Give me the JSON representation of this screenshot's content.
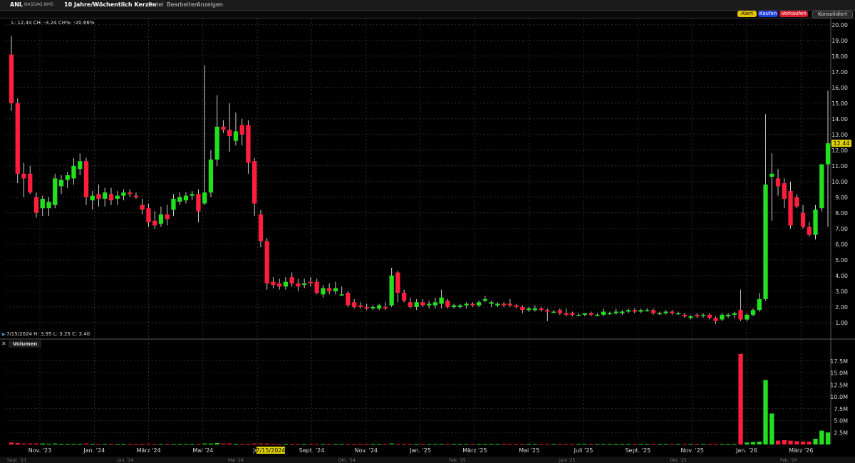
{
  "toolbar": {
    "symbol": "ANL",
    "exchange": "NASDAQ.NMS",
    "period_label": "10 Jahre/Wöchentlich Kerzen",
    "menu": [
      "Datei",
      "Bearbeiten",
      "Anzeigen"
    ],
    "buttons": {
      "alert": "Alert",
      "buy": "Kaufen",
      "sell": "Verkaufen",
      "consolidated": "Konsolidiert"
    }
  },
  "legend_text": "L: 12.44 CH: -3.24 CH%: -20.66%",
  "hover_text": "7/15/2024  H: 3.95  L: 3.25  C: 3.40",
  "volume_label": "Volumen",
  "last_price_label": "12.44",
  "crosshair_date_label": "7/15/2024",
  "colors": {
    "up": "#22e01e",
    "down": "#ff1e3c",
    "grid": "#4a4a4a",
    "last_price_tag": "#e3d400"
  },
  "chart_data": {
    "type": "candlestick",
    "price_axis": {
      "ticks": [
        "1.00",
        "2.00",
        "3.00",
        "4.00",
        "5.00",
        "6.00",
        "7.00",
        "8.00",
        "9.00",
        "10.00",
        "11.00",
        "12.00",
        "13.00",
        "14.00",
        "15.00",
        "16.00",
        "17.00",
        "18.00",
        "19.00",
        "20.00"
      ],
      "range": [
        0.45,
        20.4
      ]
    },
    "volume_axis": {
      "ticks": [
        "2.5M",
        "5.0M",
        "7.5M",
        "10.0M",
        "12.5M",
        "15.0M",
        "17.5M"
      ],
      "range": [
        0,
        20
      ]
    },
    "x_labels": [
      "Nov. '23",
      "Jan. '24",
      "März '24",
      "Mai '24",
      "Juli",
      "Sept. '24",
      "Nov. '24",
      "Jan. '25",
      "März '25",
      "Mai '25",
      "Juli '25",
      "Sept. '25",
      "Nov. '25",
      "Jan. '26",
      "März '26"
    ],
    "secondary_x_labels": [
      "Sept. '23",
      "Jan. '24",
      "Mai '24",
      "Okt. '24",
      "Feb. '25",
      "Juni '25",
      "Okt. '25",
      "Feb. '26"
    ],
    "candles": [
      [
        18.1,
        19.3,
        14.5,
        15.0,
        0.4
      ],
      [
        15.0,
        15.3,
        9.9,
        10.5,
        0.3
      ],
      [
        10.5,
        11.2,
        9.0,
        10.2,
        0.2
      ],
      [
        10.5,
        11.0,
        9.2,
        9.3,
        0.2
      ],
      [
        9.0,
        9.3,
        7.7,
        8.0,
        0.2
      ],
      [
        8.3,
        9.1,
        7.8,
        8.9,
        0.2
      ],
      [
        8.3,
        9.0,
        7.8,
        8.7,
        0.1
      ],
      [
        8.5,
        10.5,
        8.3,
        10.2,
        0.2
      ],
      [
        9.7,
        10.4,
        9.2,
        10.1,
        0.1
      ],
      [
        10.1,
        10.6,
        9.6,
        10.4,
        0.1
      ],
      [
        10.2,
        11.5,
        9.8,
        11.0,
        0.1
      ],
      [
        10.8,
        11.8,
        10.4,
        11.3,
        0.1
      ],
      [
        11.3,
        11.5,
        8.5,
        9.0,
        0.2
      ],
      [
        8.8,
        9.4,
        8.2,
        9.1,
        0.1
      ],
      [
        9.2,
        9.8,
        8.4,
        8.9,
        0.1
      ],
      [
        8.9,
        9.6,
        8.4,
        9.3,
        0.1
      ],
      [
        9.2,
        9.6,
        8.5,
        8.8,
        0.1
      ],
      [
        8.9,
        9.4,
        8.5,
        9.1,
        0.1
      ],
      [
        9.1,
        9.5,
        8.8,
        9.3,
        0.1
      ],
      [
        9.3,
        9.5,
        9.0,
        9.2,
        0.1
      ],
      [
        9.1,
        9.3,
        8.9,
        9.0,
        0.1
      ],
      [
        8.5,
        8.9,
        7.9,
        8.2,
        0.1
      ],
      [
        8.3,
        8.6,
        7.1,
        7.4,
        0.1
      ],
      [
        7.5,
        8.1,
        7.0,
        7.2,
        0.1
      ],
      [
        7.3,
        8.4,
        7.1,
        7.9,
        0.1
      ],
      [
        7.9,
        8.5,
        7.2,
        7.6,
        0.1
      ],
      [
        8.2,
        9.2,
        7.8,
        8.9,
        0.1
      ],
      [
        8.7,
        9.3,
        8.5,
        9.0,
        0.1
      ],
      [
        8.8,
        9.3,
        8.6,
        9.1,
        0.1
      ],
      [
        9.1,
        9.4,
        8.8,
        9.2,
        0.1
      ],
      [
        9.2,
        9.5,
        7.4,
        8.1,
        0.1
      ],
      [
        8.6,
        17.4,
        8.5,
        9.3,
        0.2
      ],
      [
        9.3,
        12.0,
        9.0,
        11.4,
        0.2
      ],
      [
        11.4,
        15.5,
        11.0,
        13.5,
        0.3
      ],
      [
        13.5,
        13.9,
        13.1,
        13.3,
        0.2
      ],
      [
        13.3,
        15.0,
        11.9,
        12.9,
        0.2
      ],
      [
        12.6,
        14.4,
        12.3,
        13.2,
        0.1
      ],
      [
        13.6,
        14.0,
        12.3,
        13.0,
        0.1
      ],
      [
        13.6,
        13.9,
        10.5,
        11.2,
        0.1
      ],
      [
        11.3,
        11.5,
        7.8,
        8.6,
        0.2
      ],
      [
        7.9,
        8.2,
        5.8,
        6.2,
        0.2
      ],
      [
        6.2,
        6.4,
        3.1,
        3.5,
        0.2
      ],
      [
        3.6,
        3.9,
        3.2,
        3.4,
        0.1
      ],
      [
        3.5,
        3.8,
        3.1,
        3.3,
        0.1
      ],
      [
        3.3,
        3.9,
        3.1,
        3.6,
        0.1
      ],
      [
        3.9,
        4.2,
        3.3,
        3.5,
        0.1
      ],
      [
        3.5,
        3.8,
        3.0,
        3.3,
        0.1
      ],
      [
        3.4,
        3.8,
        3.2,
        3.5,
        0.1
      ],
      [
        3.6,
        3.9,
        3.3,
        3.5,
        0.1
      ],
      [
        3.6,
        3.8,
        2.8,
        2.9,
        0.1
      ],
      [
        2.8,
        3.4,
        2.6,
        3.2,
        0.1
      ],
      [
        3.2,
        3.5,
        2.8,
        3.0,
        0.1
      ],
      [
        3.0,
        3.6,
        2.8,
        3.2,
        0.1
      ],
      [
        2.8,
        3.3,
        2.7,
        2.8,
        0.1
      ],
      [
        2.9,
        3.0,
        2.0,
        2.1,
        0.1
      ],
      [
        2.3,
        2.5,
        1.9,
        2.0,
        0.1
      ],
      [
        2.1,
        2.3,
        1.9,
        2.0,
        0.1
      ],
      [
        2.0,
        2.2,
        1.8,
        1.9,
        0.1
      ],
      [
        1.9,
        2.1,
        1.8,
        2.0,
        0.1
      ],
      [
        1.9,
        2.2,
        1.8,
        2.1,
        0.1
      ],
      [
        2.0,
        2.3,
        1.8,
        1.9,
        0.1
      ],
      [
        2.1,
        4.5,
        2.0,
        4.0,
        0.2
      ],
      [
        4.2,
        4.3,
        2.3,
        2.9,
        0.1
      ],
      [
        2.9,
        3.1,
        2.3,
        2.4,
        0.1
      ],
      [
        2.3,
        2.6,
        1.9,
        2.0,
        0.1
      ],
      [
        2.0,
        2.5,
        1.8,
        2.3,
        0.1
      ],
      [
        2.3,
        2.5,
        2.0,
        2.1,
        0.1
      ],
      [
        2.1,
        2.4,
        1.9,
        2.2,
        0.1
      ],
      [
        2.1,
        2.6,
        1.9,
        2.3,
        0.1
      ],
      [
        2.2,
        3.1,
        1.9,
        2.6,
        0.1
      ],
      [
        2.4,
        2.5,
        1.9,
        2.0,
        0.1
      ],
      [
        2.0,
        2.2,
        1.9,
        2.1,
        0.1
      ],
      [
        2.0,
        2.2,
        1.9,
        2.1,
        0.1
      ],
      [
        2.1,
        2.3,
        1.9,
        2.2,
        0.1
      ],
      [
        2.2,
        2.3,
        2.0,
        2.1,
        0.1
      ],
      [
        2.1,
        2.4,
        2.0,
        2.3,
        0.1
      ],
      [
        2.4,
        2.7,
        2.3,
        2.5,
        0.1
      ],
      [
        2.2,
        2.4,
        2.0,
        2.3,
        0.1
      ],
      [
        2.1,
        2.3,
        2.0,
        2.2,
        0.1
      ],
      [
        2.2,
        2.3,
        2.0,
        2.1,
        0.1
      ],
      [
        2.2,
        2.5,
        2.0,
        2.1,
        0.1
      ],
      [
        2.1,
        2.2,
        1.9,
        2.0,
        0.1
      ],
      [
        2.0,
        2.1,
        1.6,
        1.8,
        0.1
      ],
      [
        1.8,
        2.0,
        1.7,
        1.9,
        0.1
      ],
      [
        1.8,
        2.1,
        1.7,
        1.9,
        0.1
      ],
      [
        1.9,
        2.0,
        1.7,
        1.8,
        0.1
      ],
      [
        1.8,
        1.9,
        1.1,
        1.7,
        0.1
      ],
      [
        1.7,
        1.8,
        1.6,
        1.7,
        0.1
      ],
      [
        1.8,
        1.9,
        1.5,
        1.6,
        0.1
      ],
      [
        1.6,
        1.9,
        1.4,
        1.5,
        0.1
      ],
      [
        1.6,
        1.7,
        1.4,
        1.5,
        0.1
      ],
      [
        1.5,
        1.6,
        1.4,
        1.5,
        0.1
      ],
      [
        1.5,
        1.6,
        1.4,
        1.6,
        0.1
      ],
      [
        1.6,
        1.7,
        1.4,
        1.5,
        0.1
      ],
      [
        1.5,
        1.6,
        1.4,
        1.5,
        0.1
      ],
      [
        1.5,
        1.9,
        1.4,
        1.7,
        0.1
      ],
      [
        1.6,
        1.7,
        1.5,
        1.6,
        0.1
      ],
      [
        1.6,
        1.9,
        1.5,
        1.7,
        0.1
      ],
      [
        1.6,
        1.8,
        1.5,
        1.7,
        0.1
      ],
      [
        1.7,
        1.9,
        1.6,
        1.8,
        0.1
      ],
      [
        1.8,
        1.9,
        1.6,
        1.7,
        0.1
      ],
      [
        1.7,
        1.9,
        1.6,
        1.8,
        0.1
      ],
      [
        1.8,
        1.9,
        1.7,
        1.8,
        0.1
      ],
      [
        1.8,
        1.9,
        1.5,
        1.6,
        0.1
      ],
      [
        1.6,
        1.7,
        1.5,
        1.6,
        0.1
      ],
      [
        1.6,
        1.8,
        1.5,
        1.7,
        0.1
      ],
      [
        1.7,
        1.8,
        1.5,
        1.6,
        0.1
      ],
      [
        1.6,
        1.7,
        1.5,
        1.6,
        0.1
      ],
      [
        1.5,
        1.6,
        1.3,
        1.4,
        0.1
      ],
      [
        1.3,
        1.5,
        1.2,
        1.4,
        0.1
      ],
      [
        1.5,
        1.6,
        1.3,
        1.4,
        0.1
      ],
      [
        1.5,
        1.6,
        1.3,
        1.5,
        0.1
      ],
      [
        1.5,
        1.6,
        1.2,
        1.3,
        0.1
      ],
      [
        1.3,
        1.4,
        0.9,
        1.1,
        0.1
      ],
      [
        1.2,
        1.6,
        1.1,
        1.5,
        0.1
      ],
      [
        1.4,
        1.6,
        1.3,
        1.5,
        0.1
      ],
      [
        1.5,
        1.7,
        1.3,
        1.6,
        0.1
      ],
      [
        1.8,
        3.1,
        1.1,
        1.2,
        19.0
      ],
      [
        1.2,
        1.6,
        1.1,
        1.5,
        0.4
      ],
      [
        1.5,
        1.9,
        1.4,
        1.8,
        0.5
      ],
      [
        1.8,
        2.9,
        1.7,
        2.5,
        0.6
      ],
      [
        2.5,
        14.3,
        2.4,
        9.8,
        13.5
      ],
      [
        10.3,
        11.8,
        7.5,
        10.5,
        6.5
      ],
      [
        10.2,
        10.8,
        9.1,
        9.7,
        0.8
      ],
      [
        9.9,
        10.2,
        8.3,
        8.9,
        0.9
      ],
      [
        9.4,
        10.0,
        7.0,
        7.2,
        0.8
      ],
      [
        9.0,
        9.2,
        8.3,
        8.4,
        0.7
      ],
      [
        8.0,
        8.5,
        7.0,
        7.1,
        0.6
      ],
      [
        7.1,
        7.4,
        6.5,
        6.6,
        0.6
      ],
      [
        6.6,
        8.5,
        6.3,
        8.2,
        1.2
      ],
      [
        8.3,
        9.4,
        8.1,
        11.1,
        2.9
      ],
      [
        11.1,
        15.8,
        7.1,
        12.44,
        2.5
      ]
    ]
  }
}
